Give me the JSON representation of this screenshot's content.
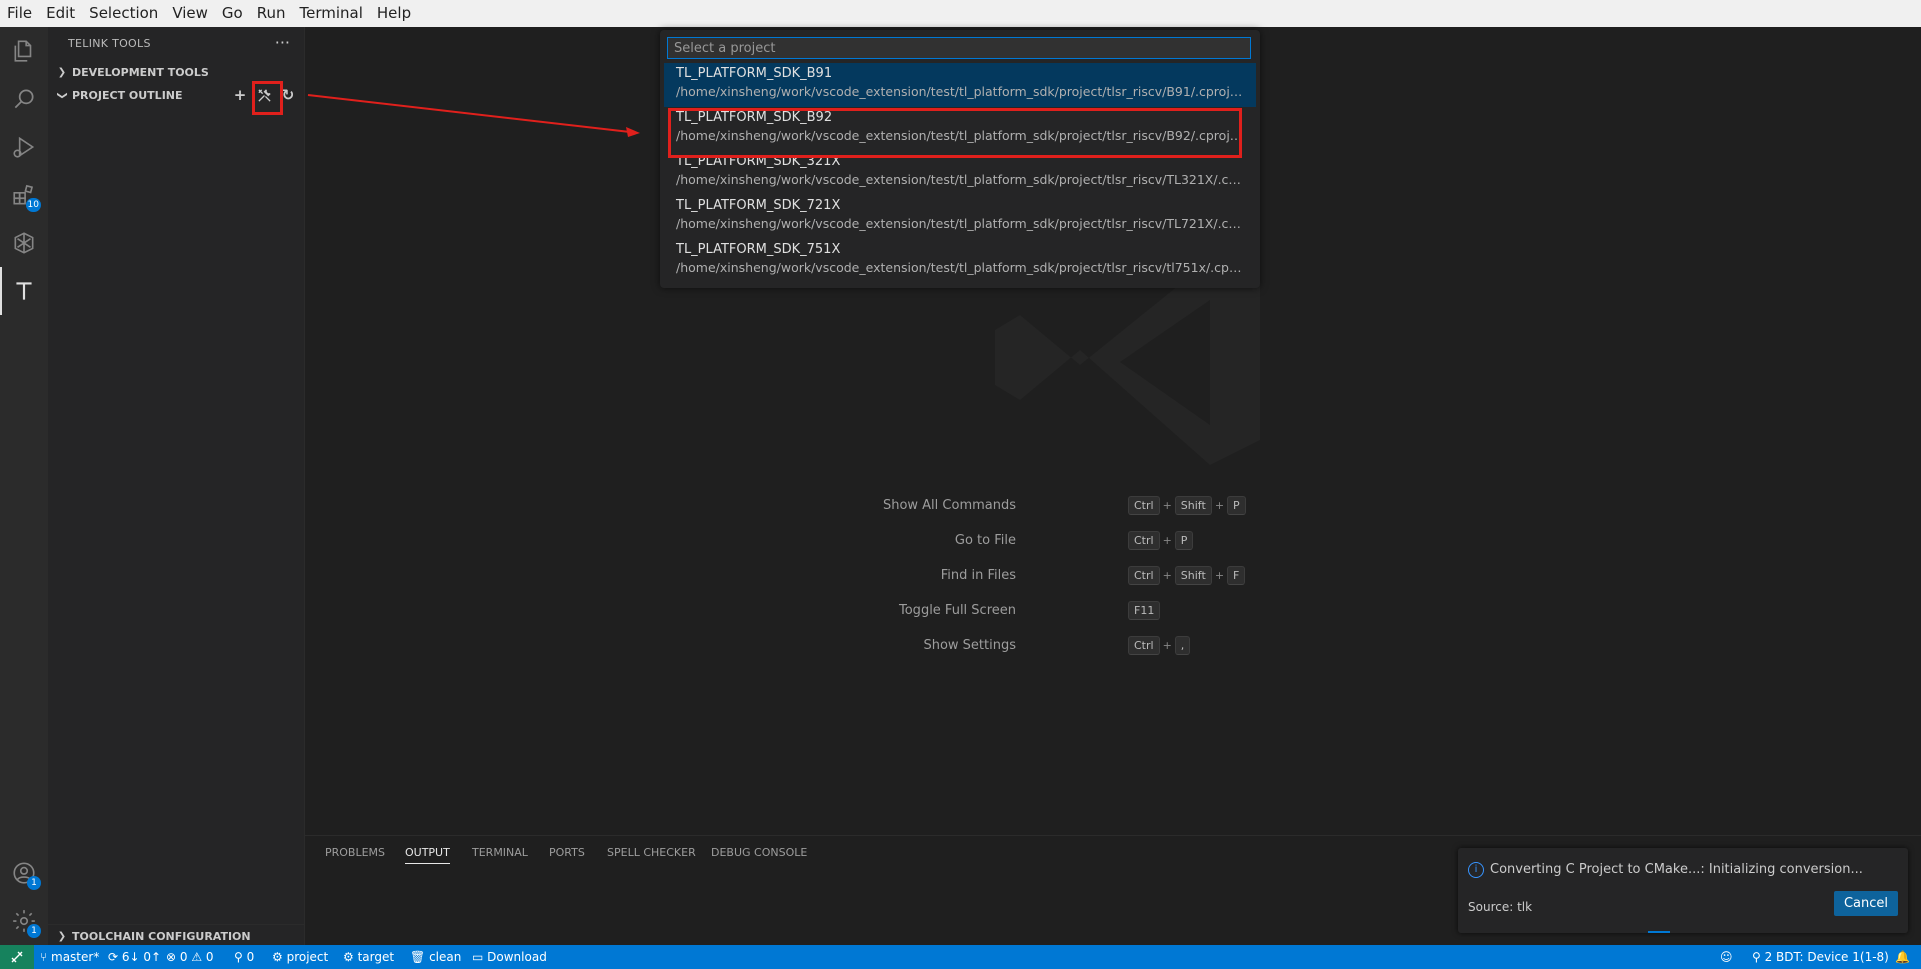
{
  "menu": [
    "File",
    "Edit",
    "Selection",
    "View",
    "Go",
    "Run",
    "Terminal",
    "Help"
  ],
  "activity": {
    "extensions_badge": "10",
    "accounts_badge": "1",
    "settings_badge": "1"
  },
  "sidebar": {
    "title": "TELINK TOOLS",
    "sections": {
      "dev_tools": "DEVELOPMENT TOOLS",
      "project_outline": "PROJECT OUTLINE",
      "toolchain": "TOOLCHAIN CONFIGURATION"
    }
  },
  "quickpick": {
    "placeholder": "Select a project",
    "items": [
      {
        "name": "TL_PLATFORM_SDK_B91",
        "path": "/home/xinsheng/work/vscode_extension/test/tl_platform_sdk/project/tlsr_riscv/B91/.cproject"
      },
      {
        "name": "TL_PLATFORM_SDK_B92",
        "path": "/home/xinsheng/work/vscode_extension/test/tl_platform_sdk/project/tlsr_riscv/B92/.cproject"
      },
      {
        "name": "TL_PLATFORM_SDK_321X",
        "path": "/home/xinsheng/work/vscode_extension/test/tl_platform_sdk/project/tlsr_riscv/TL321X/.cpr..."
      },
      {
        "name": "TL_PLATFORM_SDK_721X",
        "path": "/home/xinsheng/work/vscode_extension/test/tl_platform_sdk/project/tlsr_riscv/TL721X/.cpr..."
      },
      {
        "name": "TL_PLATFORM_SDK_751X",
        "path": "/home/xinsheng/work/vscode_extension/test/tl_platform_sdk/project/tlsr_riscv/tl751x/.cproj..."
      }
    ]
  },
  "shortcuts": [
    {
      "label": "Show All Commands",
      "keys": [
        "Ctrl",
        "Shift",
        "P"
      ]
    },
    {
      "label": "Go to File",
      "keys": [
        "Ctrl",
        "P"
      ]
    },
    {
      "label": "Find in Files",
      "keys": [
        "Ctrl",
        "Shift",
        "F"
      ]
    },
    {
      "label": "Toggle Full Screen",
      "keys": [
        "F11"
      ]
    },
    {
      "label": "Show Settings",
      "keys": [
        "Ctrl",
        ","
      ]
    }
  ],
  "panel": {
    "tabs": [
      "PROBLEMS",
      "OUTPUT",
      "TERMINAL",
      "PORTS",
      "SPELL CHECKER",
      "DEBUG CONSOLE"
    ]
  },
  "notification": {
    "message": "Converting C Project to CMake...: Initializing conversion...",
    "source": "Source: tlk",
    "button": "Cancel"
  },
  "statusbar": {
    "branch": "master*",
    "sync": "6↓ 0↑",
    "errors": "0",
    "warnings": "0",
    "ports": "0",
    "project": "project",
    "target": "target",
    "clean": "clean",
    "download": "Download",
    "device": "2 BDT: Device 1(1-8)"
  }
}
